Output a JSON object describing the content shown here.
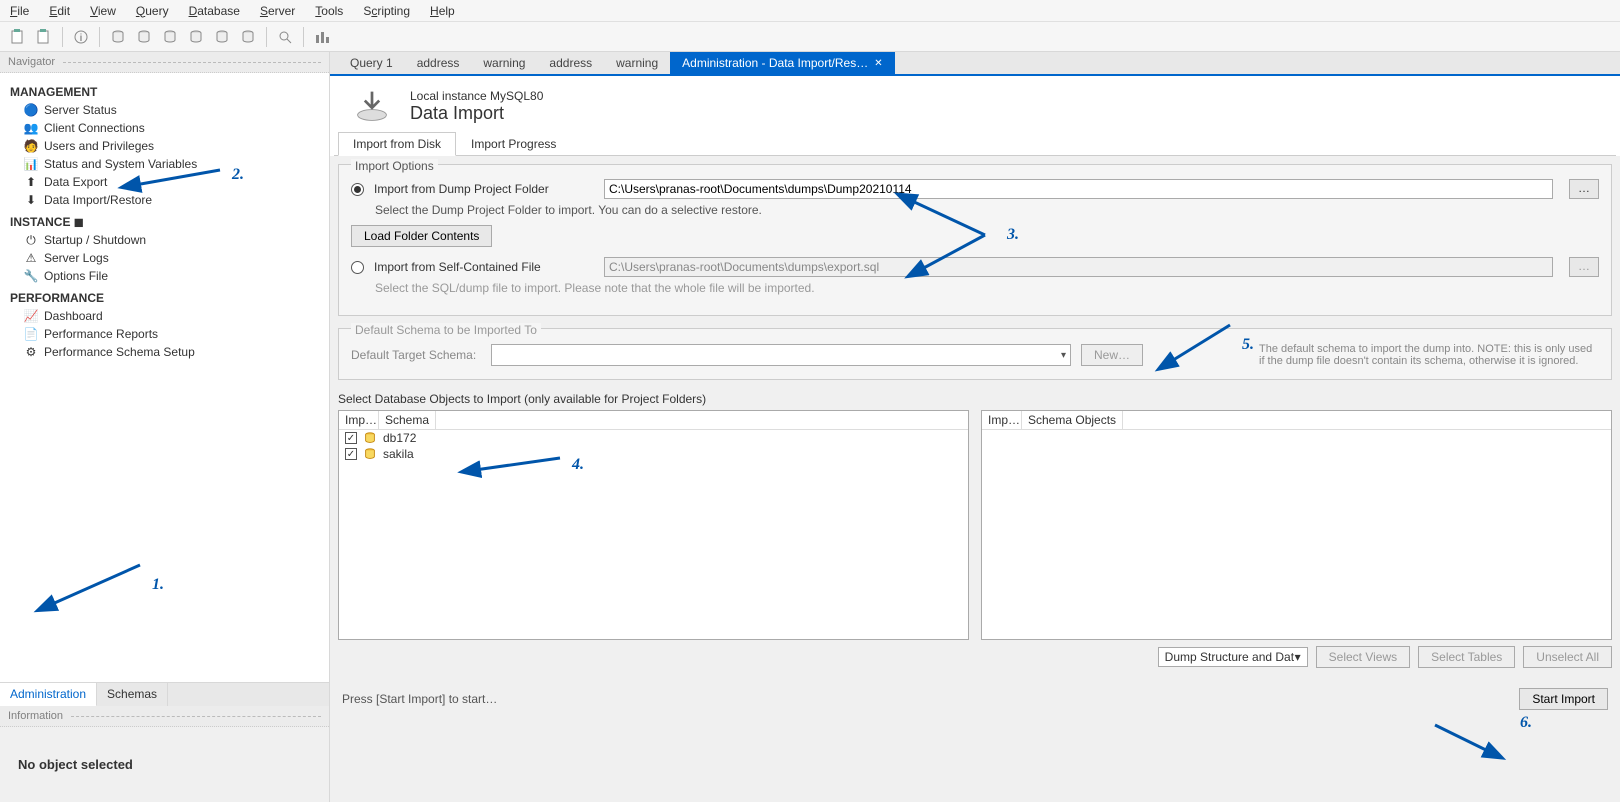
{
  "menu": [
    "File",
    "Edit",
    "View",
    "Query",
    "Database",
    "Server",
    "Tools",
    "Scripting",
    "Help"
  ],
  "sidebar": {
    "panel_title": "Navigator",
    "management": {
      "label": "MANAGEMENT",
      "items": [
        "Server Status",
        "Client Connections",
        "Users and Privileges",
        "Status and System Variables",
        "Data Export",
        "Data Import/Restore"
      ]
    },
    "instance": {
      "label": "INSTANCE",
      "items": [
        "Startup / Shutdown",
        "Server Logs",
        "Options File"
      ]
    },
    "performance": {
      "label": "PERFORMANCE",
      "items": [
        "Dashboard",
        "Performance Reports",
        "Performance Schema Setup"
      ]
    },
    "tabs": {
      "administration": "Administration",
      "schemas": "Schemas"
    },
    "info_title": "Information",
    "info_body": "No object selected"
  },
  "editor_tabs": [
    "Query 1",
    "address",
    "warning",
    "address",
    "warning"
  ],
  "editor_tab_active": "Administration - Data Import/Res…",
  "page": {
    "subtitle": "Local instance MySQL80",
    "title": "Data Import",
    "inner_tabs": {
      "disk": "Import from Disk",
      "progress": "Import Progress"
    }
  },
  "options": {
    "group_title": "Import Options",
    "radio_folder": "Import from Dump Project Folder",
    "folder_path": "C:\\Users\\pranas-root\\Documents\\dumps\\Dump20210114",
    "folder_hint": "Select the Dump Project Folder to import. You can do a selective restore.",
    "load_btn": "Load Folder Contents",
    "radio_file": "Import from Self-Contained File",
    "file_path": "C:\\Users\\pranas-root\\Documents\\dumps\\export.sql",
    "file_hint": "Select the SQL/dump file to import. Please note that the whole file will be imported."
  },
  "schema": {
    "group_title": "Default Schema to be Imported To",
    "label": "Default Target Schema:",
    "new_btn": "New…",
    "note": "The default schema to import the dump into. NOTE: this is only used if the dump file doesn't contain its schema, otherwise it is ignored."
  },
  "objects": {
    "label": "Select Database Objects to Import (only available for Project Folders)",
    "col_imp": "Imp…",
    "col_schema": "Schema",
    "col_objects": "Schema Objects",
    "rows": [
      {
        "checked": true,
        "name": "db172"
      },
      {
        "checked": true,
        "name": "sakila"
      }
    ],
    "dump_select": "Dump Structure and Dat",
    "btn_views": "Select Views",
    "btn_tables": "Select Tables",
    "btn_unselect": "Unselect All"
  },
  "footer": {
    "hint": "Press [Start Import] to start…",
    "start_btn": "Start Import"
  },
  "browse_label": "…",
  "callouts": {
    "c1": "1.",
    "c2": "2.",
    "c3": "3.",
    "c4": "4.",
    "c5": "5.",
    "c6": "6."
  }
}
